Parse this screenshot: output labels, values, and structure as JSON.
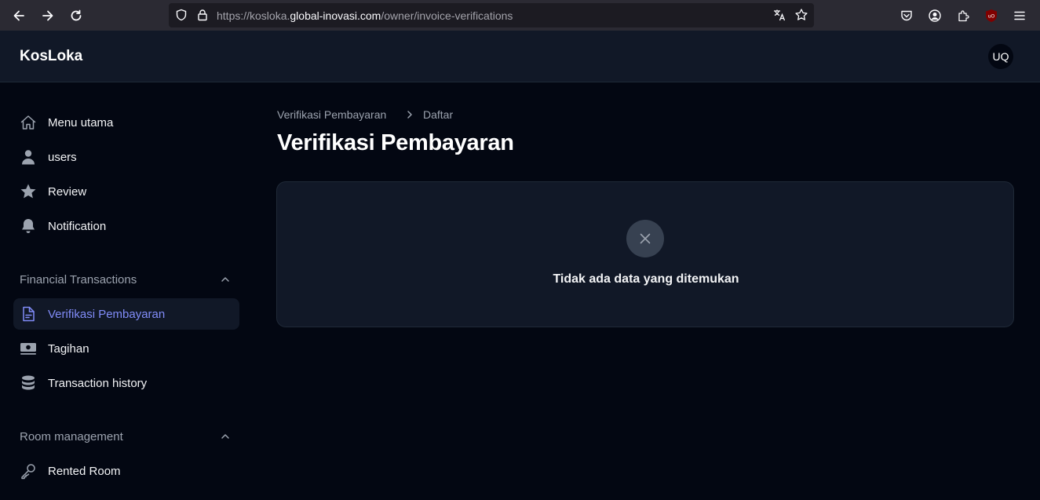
{
  "browser": {
    "url_prefix": "https://kosloka.",
    "url_host": "global-inovasi.com",
    "url_path": "/owner/invoice-verifications",
    "icons": [
      "back-icon",
      "forward-icon",
      "reload-icon",
      "shield-icon",
      "lock-icon",
      "translate-icon",
      "star-icon",
      "pocket-icon",
      "account-icon",
      "extensions-icon",
      "ublock-icon",
      "menu-icon"
    ]
  },
  "header": {
    "brand": "KosLoka",
    "avatar_initials": "UQ"
  },
  "sidebar": {
    "items": [
      {
        "label": "Menu utama",
        "icon": "home-icon"
      },
      {
        "label": "users",
        "icon": "user-icon"
      },
      {
        "label": "Review",
        "icon": "star-icon"
      },
      {
        "label": "Notification",
        "icon": "bell-icon"
      }
    ],
    "groups": [
      {
        "label": "Financial Transactions",
        "items": [
          {
            "label": "Verifikasi Pembayaran",
            "icon": "document-icon",
            "active": true
          },
          {
            "label": "Tagihan",
            "icon": "banknotes-icon"
          },
          {
            "label": "Transaction history",
            "icon": "database-icon"
          }
        ]
      },
      {
        "label": "Room management",
        "items": [
          {
            "label": "Rented Room",
            "icon": "key-icon"
          }
        ]
      }
    ]
  },
  "main": {
    "breadcrumb": [
      "Verifikasi Pembayaran",
      "Daftar"
    ],
    "title": "Verifikasi Pembayaran",
    "empty_message": "Tidak ada data yang ditemukan"
  },
  "colors": {
    "background": "#030712",
    "panel": "#111827",
    "accent": "#818cf8",
    "muted": "#9ca3af"
  }
}
